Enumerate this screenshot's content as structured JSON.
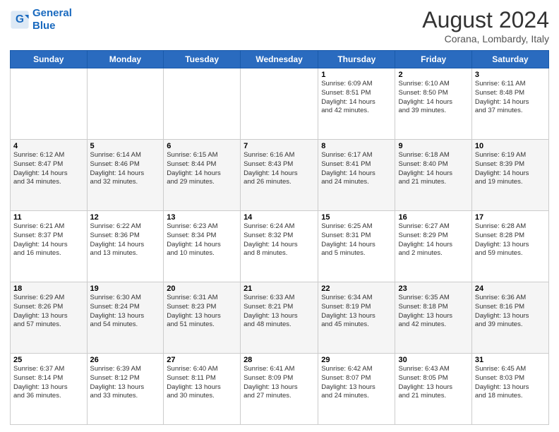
{
  "header": {
    "logo_line1": "General",
    "logo_line2": "Blue",
    "main_title": "August 2024",
    "subtitle": "Corana, Lombardy, Italy"
  },
  "weekdays": [
    "Sunday",
    "Monday",
    "Tuesday",
    "Wednesday",
    "Thursday",
    "Friday",
    "Saturday"
  ],
  "weeks": [
    [
      {
        "day": "",
        "info": ""
      },
      {
        "day": "",
        "info": ""
      },
      {
        "day": "",
        "info": ""
      },
      {
        "day": "",
        "info": ""
      },
      {
        "day": "1",
        "info": "Sunrise: 6:09 AM\nSunset: 8:51 PM\nDaylight: 14 hours\nand 42 minutes."
      },
      {
        "day": "2",
        "info": "Sunrise: 6:10 AM\nSunset: 8:50 PM\nDaylight: 14 hours\nand 39 minutes."
      },
      {
        "day": "3",
        "info": "Sunrise: 6:11 AM\nSunset: 8:48 PM\nDaylight: 14 hours\nand 37 minutes."
      }
    ],
    [
      {
        "day": "4",
        "info": "Sunrise: 6:12 AM\nSunset: 8:47 PM\nDaylight: 14 hours\nand 34 minutes."
      },
      {
        "day": "5",
        "info": "Sunrise: 6:14 AM\nSunset: 8:46 PM\nDaylight: 14 hours\nand 32 minutes."
      },
      {
        "day": "6",
        "info": "Sunrise: 6:15 AM\nSunset: 8:44 PM\nDaylight: 14 hours\nand 29 minutes."
      },
      {
        "day": "7",
        "info": "Sunrise: 6:16 AM\nSunset: 8:43 PM\nDaylight: 14 hours\nand 26 minutes."
      },
      {
        "day": "8",
        "info": "Sunrise: 6:17 AM\nSunset: 8:41 PM\nDaylight: 14 hours\nand 24 minutes."
      },
      {
        "day": "9",
        "info": "Sunrise: 6:18 AM\nSunset: 8:40 PM\nDaylight: 14 hours\nand 21 minutes."
      },
      {
        "day": "10",
        "info": "Sunrise: 6:19 AM\nSunset: 8:39 PM\nDaylight: 14 hours\nand 19 minutes."
      }
    ],
    [
      {
        "day": "11",
        "info": "Sunrise: 6:21 AM\nSunset: 8:37 PM\nDaylight: 14 hours\nand 16 minutes."
      },
      {
        "day": "12",
        "info": "Sunrise: 6:22 AM\nSunset: 8:36 PM\nDaylight: 14 hours\nand 13 minutes."
      },
      {
        "day": "13",
        "info": "Sunrise: 6:23 AM\nSunset: 8:34 PM\nDaylight: 14 hours\nand 10 minutes."
      },
      {
        "day": "14",
        "info": "Sunrise: 6:24 AM\nSunset: 8:32 PM\nDaylight: 14 hours\nand 8 minutes."
      },
      {
        "day": "15",
        "info": "Sunrise: 6:25 AM\nSunset: 8:31 PM\nDaylight: 14 hours\nand 5 minutes."
      },
      {
        "day": "16",
        "info": "Sunrise: 6:27 AM\nSunset: 8:29 PM\nDaylight: 14 hours\nand 2 minutes."
      },
      {
        "day": "17",
        "info": "Sunrise: 6:28 AM\nSunset: 8:28 PM\nDaylight: 13 hours\nand 59 minutes."
      }
    ],
    [
      {
        "day": "18",
        "info": "Sunrise: 6:29 AM\nSunset: 8:26 PM\nDaylight: 13 hours\nand 57 minutes."
      },
      {
        "day": "19",
        "info": "Sunrise: 6:30 AM\nSunset: 8:24 PM\nDaylight: 13 hours\nand 54 minutes."
      },
      {
        "day": "20",
        "info": "Sunrise: 6:31 AM\nSunset: 8:23 PM\nDaylight: 13 hours\nand 51 minutes."
      },
      {
        "day": "21",
        "info": "Sunrise: 6:33 AM\nSunset: 8:21 PM\nDaylight: 13 hours\nand 48 minutes."
      },
      {
        "day": "22",
        "info": "Sunrise: 6:34 AM\nSunset: 8:19 PM\nDaylight: 13 hours\nand 45 minutes."
      },
      {
        "day": "23",
        "info": "Sunrise: 6:35 AM\nSunset: 8:18 PM\nDaylight: 13 hours\nand 42 minutes."
      },
      {
        "day": "24",
        "info": "Sunrise: 6:36 AM\nSunset: 8:16 PM\nDaylight: 13 hours\nand 39 minutes."
      }
    ],
    [
      {
        "day": "25",
        "info": "Sunrise: 6:37 AM\nSunset: 8:14 PM\nDaylight: 13 hours\nand 36 minutes."
      },
      {
        "day": "26",
        "info": "Sunrise: 6:39 AM\nSunset: 8:12 PM\nDaylight: 13 hours\nand 33 minutes."
      },
      {
        "day": "27",
        "info": "Sunrise: 6:40 AM\nSunset: 8:11 PM\nDaylight: 13 hours\nand 30 minutes."
      },
      {
        "day": "28",
        "info": "Sunrise: 6:41 AM\nSunset: 8:09 PM\nDaylight: 13 hours\nand 27 minutes."
      },
      {
        "day": "29",
        "info": "Sunrise: 6:42 AM\nSunset: 8:07 PM\nDaylight: 13 hours\nand 24 minutes."
      },
      {
        "day": "30",
        "info": "Sunrise: 6:43 AM\nSunset: 8:05 PM\nDaylight: 13 hours\nand 21 minutes."
      },
      {
        "day": "31",
        "info": "Sunrise: 6:45 AM\nSunset: 8:03 PM\nDaylight: 13 hours\nand 18 minutes."
      }
    ]
  ]
}
